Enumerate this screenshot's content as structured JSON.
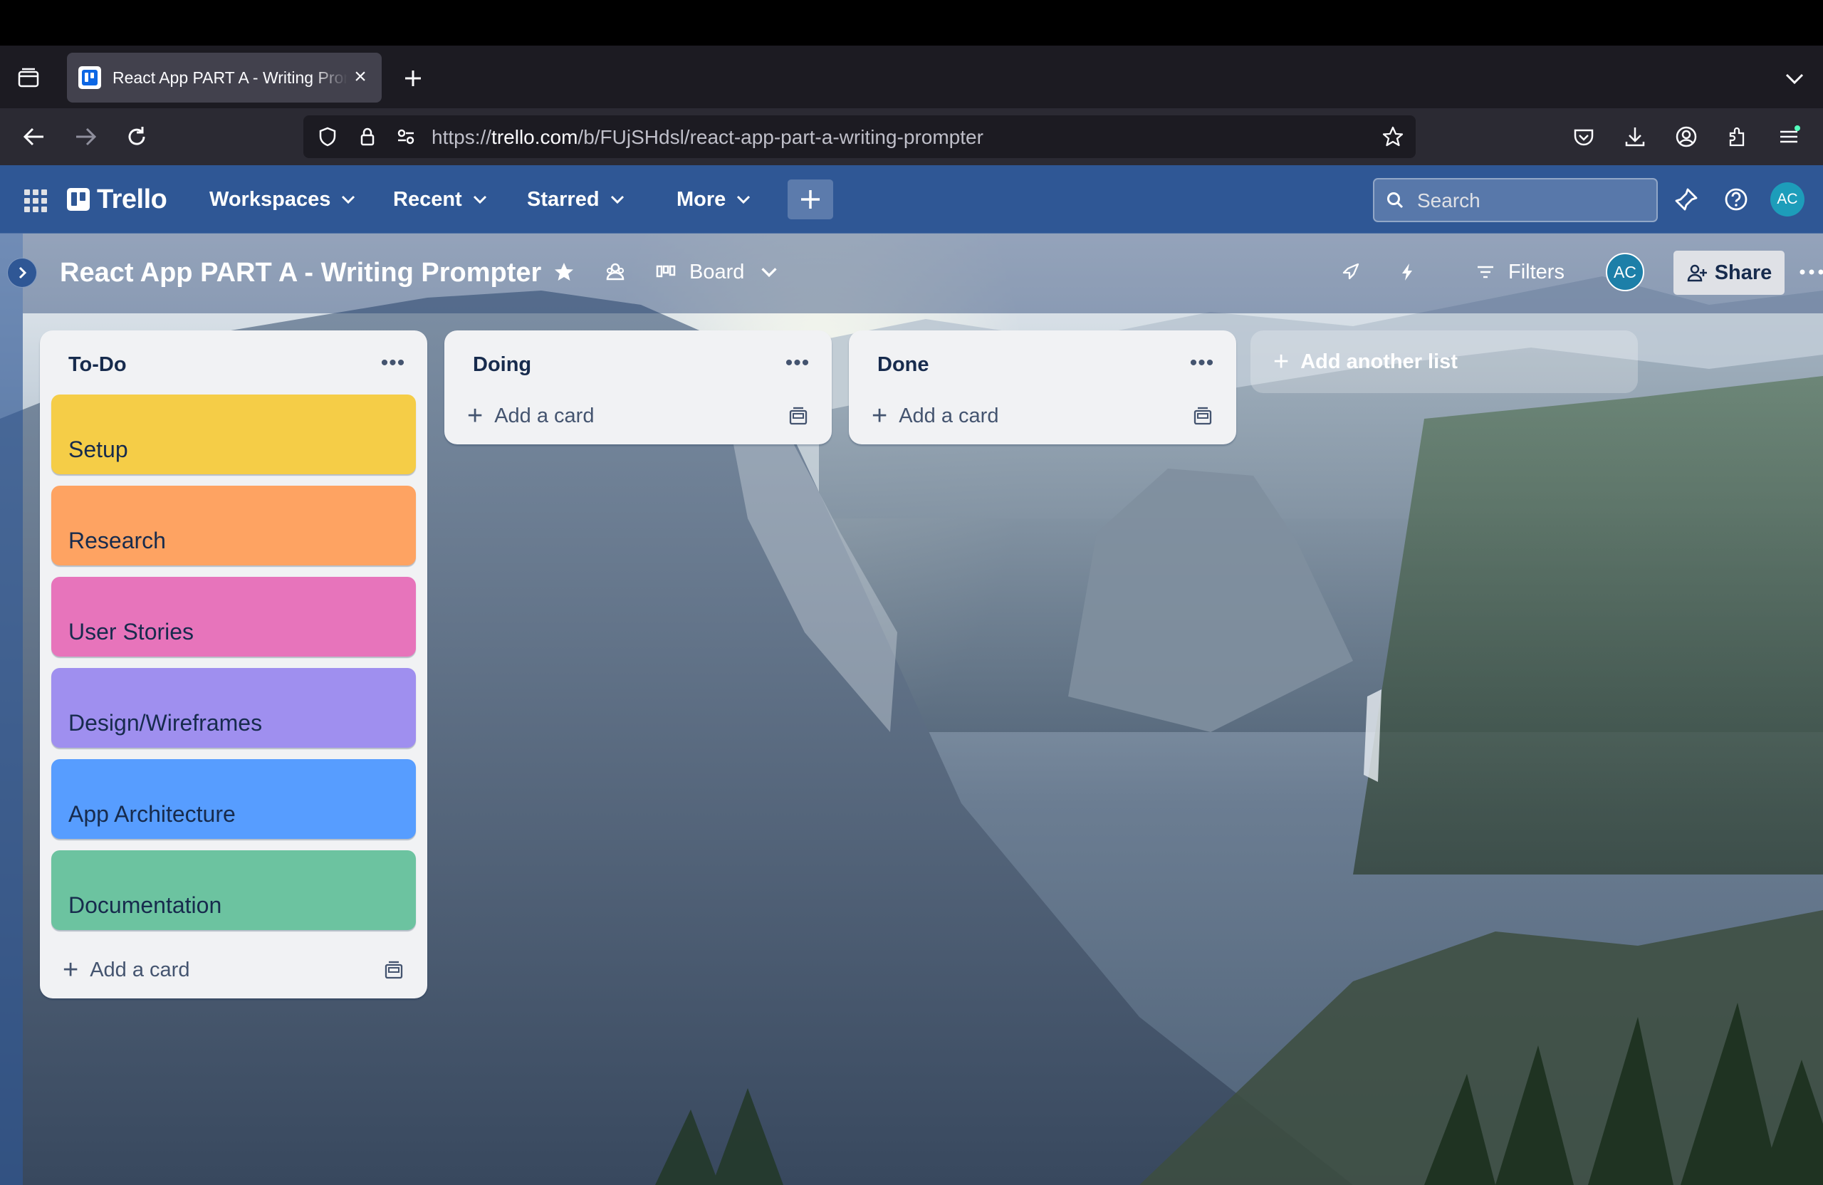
{
  "browser": {
    "tab_title": "React App PART A - Writing Prompter",
    "url_prefix": "https://",
    "url_host": "trello.com",
    "url_path": "/b/FUjSHdsl/react-app-part-a-writing-prompter"
  },
  "header": {
    "logo_text": "Trello",
    "menus": [
      {
        "label": "Workspaces"
      },
      {
        "label": "Recent"
      },
      {
        "label": "Starred"
      },
      {
        "label": "More"
      }
    ],
    "search_placeholder": "Search",
    "avatar_initials": "AC"
  },
  "board": {
    "title": "React App PART A - Writing Prompter",
    "view_label": "Board",
    "filters_label": "Filters",
    "member_initials": "AC",
    "share_label": "Share",
    "add_list_label": "Add another list",
    "lists": [
      {
        "title": "To-Do",
        "add_card_label": "Add a card",
        "cards": [
          {
            "label": "Setup",
            "color": "#f5cd47"
          },
          {
            "label": "Research",
            "color": "#fea362"
          },
          {
            "label": "User Stories",
            "color": "#e774bb"
          },
          {
            "label": "Design/Wireframes",
            "color": "#9f8fef"
          },
          {
            "label": "App Architecture",
            "color": "#579dff"
          },
          {
            "label": "Documentation",
            "color": "#6cc3a0"
          }
        ]
      },
      {
        "title": "Doing",
        "add_card_label": "Add a card",
        "cards": []
      },
      {
        "title": "Done",
        "add_card_label": "Add a card",
        "cards": []
      }
    ]
  }
}
